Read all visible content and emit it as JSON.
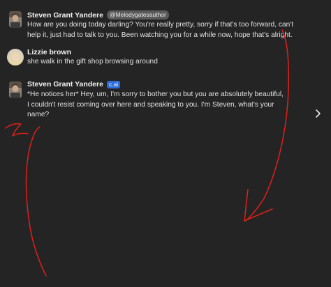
{
  "messages": [
    {
      "author": "Steven Grant Yandere",
      "badge": "@Melodygatesauthor",
      "lines": [
        "How are you doing today darling? You're really pretty, sorry if that's too forward, can't",
        "help it, just had to talk to you. Been watching you for a while now, hope that's alright."
      ]
    },
    {
      "author": "Lizzie brown",
      "lines": [
        "she walk in the gift shop browsing around"
      ]
    },
    {
      "author": "Steven Grant Yandere",
      "badge": "c.ai",
      "lines": [
        "*He notices her* Hey, um, I'm sorry to bother you but you are absolutely beautiful,",
        "I couldn't resist coming over here and speaking to you. I'm Steven, what's your",
        "name?"
      ]
    }
  ],
  "icons": {
    "next": "chevron-right-icon"
  },
  "colors": {
    "background": "#242424",
    "annotation": "#e0201a",
    "cai_badge": "#2c6cd6"
  }
}
